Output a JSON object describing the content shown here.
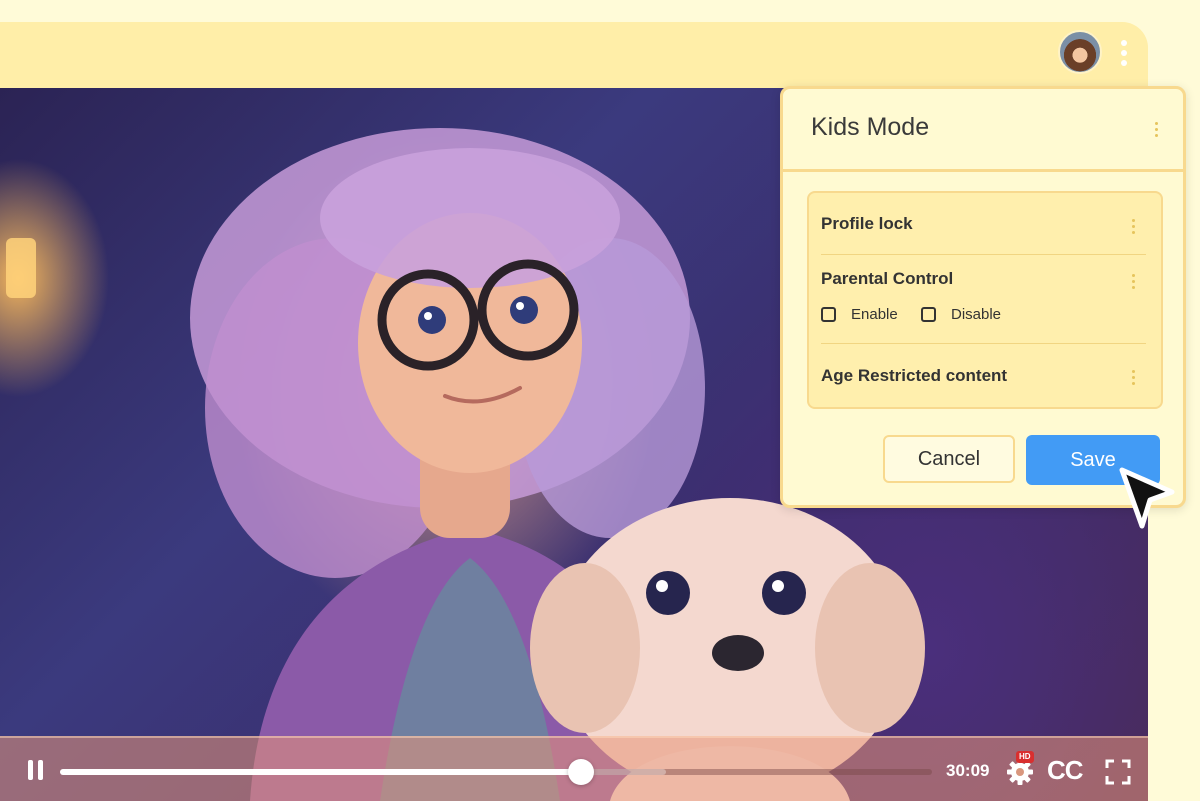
{
  "header": {
    "avatar_icon": "user-avatar",
    "menu_icon": "kebab-menu-icon"
  },
  "panel": {
    "title": "Kids Mode",
    "settings": [
      {
        "label": "Profile lock"
      },
      {
        "label": "Parental Control",
        "options": [
          {
            "label": "Enable",
            "checked": false
          },
          {
            "label": "Disable",
            "checked": false
          }
        ]
      },
      {
        "label": "Age Restricted content"
      }
    ],
    "cancel_label": "Cancel",
    "save_label": "Save"
  },
  "player": {
    "state": "playing",
    "progress_fraction": 0.597,
    "buffered_fraction": 0.695,
    "time": "30:09",
    "hd_badge": "HD",
    "cc_label": "CC"
  },
  "colors": {
    "background": "#fffbd8",
    "top_bar": "#ffeea8",
    "panel_background": "#fffad2",
    "panel_border": "#f8d98e",
    "save_button": "#429bf5",
    "hd_badge": "#d92f2f"
  }
}
